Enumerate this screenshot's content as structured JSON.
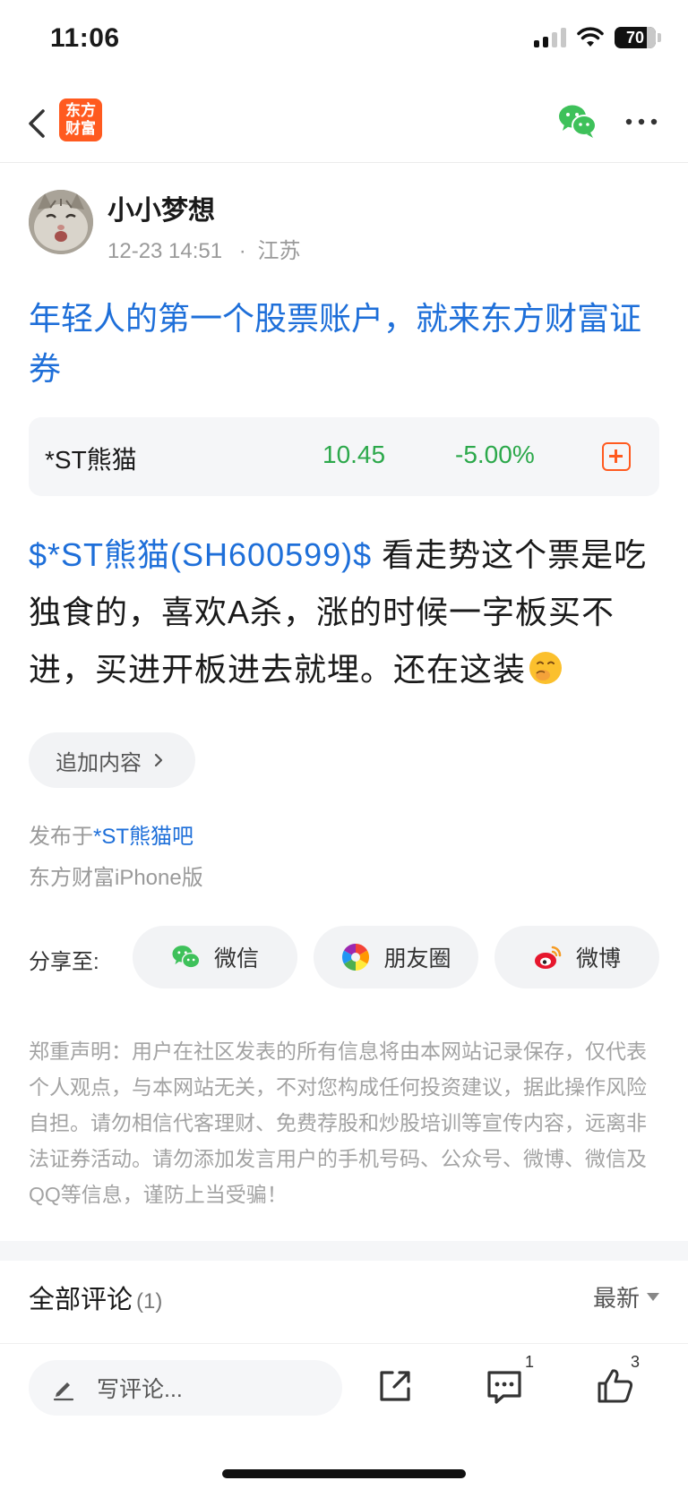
{
  "status_bar": {
    "time": "11:06",
    "battery": "70"
  },
  "nav": {
    "logo_line1": "东方",
    "logo_line2": "财富"
  },
  "author": {
    "name": "小小梦想",
    "time": "12-23 14:51",
    "dot": "·",
    "location": "江苏"
  },
  "post": {
    "title": "年轻人的第一个股票账户，就来东方财富证券",
    "stock_link": "$*ST熊猫(SH600599)$",
    "body_text": "  看走势这个票是吃独食的，喜欢A杀，涨的时候一字板买不进，买进开板进去就埋。还在这装"
  },
  "stock_card": {
    "name": "*ST熊猫",
    "price": "10.45",
    "change": "-5.00%"
  },
  "append_button": {
    "label": "追加内容"
  },
  "published_in": {
    "prefix": "发布于",
    "bar": "*ST熊猫吧"
  },
  "client_info": "东方财富iPhone版",
  "share": {
    "label": "分享至:",
    "wechat": "微信",
    "moments": "朋友圈",
    "weibo": "微博"
  },
  "disclaimer": "郑重声明：用户在社区发表的所有信息将由本网站记录保存，仅代表个人观点，与本网站无关，不对您构成任何投资建议，据此操作风险自担。请勿相信代客理财、免费荐股和炒股培训等宣传内容，远离非法证券活动。请勿添加发言用户的手机号码、公众号、微博、微信及QQ等信息，谨防上当受骗！",
  "comments": {
    "title": "全部评论",
    "count": "(1)",
    "sort": "最新"
  },
  "bottom_bar": {
    "placeholder": "写评论...",
    "comment_count": "1",
    "like_count": "3"
  },
  "colors": {
    "accent": "#ff5a1f",
    "link": "#1e6fd9",
    "down": "#2ba84a"
  }
}
